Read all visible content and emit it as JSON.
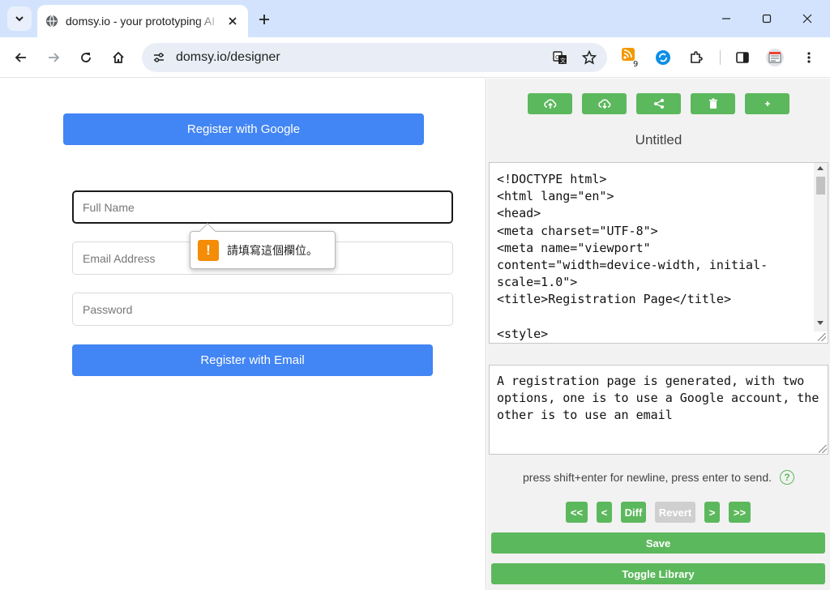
{
  "browser": {
    "tab_title": "domsy.io - your prototyping AI",
    "url": "domsy.io/designer",
    "extension_badge": "9"
  },
  "preview": {
    "google_button": "Register with Google",
    "full_name_placeholder": "Full Name",
    "email_placeholder": "Email Address",
    "password_placeholder": "Password",
    "email_button": "Register with Email",
    "validation_message": "請填寫這個欄位。",
    "validation_icon": "!"
  },
  "designer": {
    "title": "Untitled",
    "code_lines": [
      "<!DOCTYPE html>",
      "<html lang=\"en\">",
      "<head>",
      "<meta charset=\"UTF-8\">",
      "<meta name=\"viewport\"",
      "content=\"width=device-width, initial-",
      "scale=1.0\">",
      "<title>Registration Page</title>",
      "",
      "<style>"
    ],
    "prompt": "A registration page is generated, with two options, one is to use a Google account, the other is to use an email",
    "hint": "press shift+enter for newline, press enter to send.",
    "help_icon": "?",
    "history": {
      "first": "<<",
      "prev": "<",
      "diff": "Diff",
      "revert": "Revert",
      "next": ">",
      "last": ">>"
    },
    "save": "Save",
    "toggle_library": "Toggle Library"
  },
  "colors": {
    "primary_blue": "#4285f4",
    "action_green": "#5cb85c",
    "warning_orange": "#f48c06"
  }
}
